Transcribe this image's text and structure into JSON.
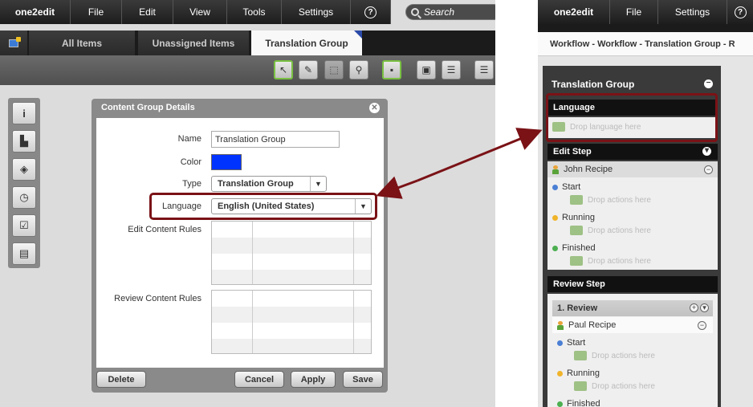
{
  "left_app": {
    "menu": [
      "one2edit",
      "File",
      "Edit",
      "View",
      "Tools",
      "Settings"
    ],
    "help_label": "?",
    "search_placeholder": "Search",
    "tabs": {
      "all_items": "All Items",
      "unassigned_items": "Unassigned Items",
      "translation_group": "Translation Group"
    }
  },
  "dialog": {
    "title": "Content Group Details",
    "name_label": "Name",
    "name_value": "Translation Group",
    "color_label": "Color",
    "color_value": "#0033ff",
    "type_label": "Type",
    "type_value": "Translation Group",
    "language_label": "Language",
    "language_value": "English (United States)",
    "edit_rules_label": "Edit Content Rules",
    "review_rules_label": "Review Content Rules",
    "buttons": {
      "delete": "Delete",
      "cancel": "Cancel",
      "apply": "Apply",
      "save": "Save"
    }
  },
  "right_app": {
    "menu": [
      "one2edit",
      "File",
      "Settings"
    ],
    "breadcrumb": "Workflow - Workflow - Translation Group - R",
    "panel_title": "Translation Group",
    "language": {
      "head": "Language",
      "drop": "Drop language here"
    },
    "edit_step": {
      "head": "Edit Step",
      "user": "John Recipe",
      "start": "Start",
      "running": "Running",
      "finished": "Finished",
      "drop_actions": "Drop actions here"
    },
    "review_step": {
      "head": "Review Step",
      "sub": "1. Review",
      "user": "Paul Recipe",
      "start": "Start",
      "running": "Running",
      "finished": "Finished",
      "drop_actions": "Drop actions here"
    }
  },
  "colors": {
    "highlight": "#7a1216",
    "status_start": "#4a7fd4",
    "status_running": "#f0b429",
    "status_finished": "#4caf50"
  }
}
